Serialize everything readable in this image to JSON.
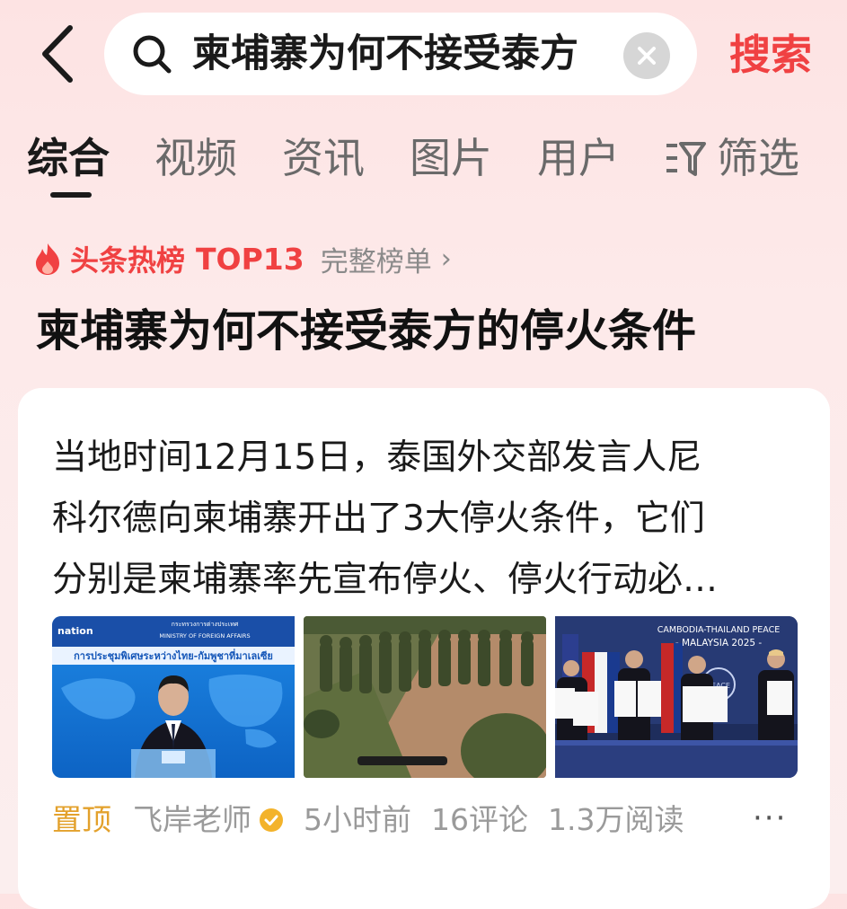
{
  "search": {
    "query": "柬埔寨为何不接受泰方",
    "submit_label": "搜索"
  },
  "tabs": [
    {
      "label": "综合",
      "active": true
    },
    {
      "label": "视频"
    },
    {
      "label": "资讯"
    },
    {
      "label": "图片"
    },
    {
      "label": "用户"
    },
    {
      "label": "筛选"
    }
  ],
  "hot": {
    "badge": "头条热榜",
    "rank": "TOP13",
    "full_list": "完整榜单",
    "title": "柬埔寨为何不接受泰方的停火条件"
  },
  "article": {
    "summary_lines": [
      "当地时间12月15日，泰国外交部发言人尼",
      "科尔德向柬埔寨开出了3大停火条件，它们",
      "分别是柬埔寨率先宣布停火、停火行动必…"
    ],
    "images": [
      {
        "logo": "nation",
        "ministry_thai": "กระทรวงการต่างประเทศ",
        "ministry_en": "MINISTRY OF FOREIGN AFFAIRS",
        "banner": "การประชุมพิเศษระหว่างไทย-กัมพูชาที่มาเลเซีย"
      },
      {},
      {
        "banner_line1": "CAMBODIA-THAILAND PEACE",
        "banner_line2": "- MALAYSIA 2025 -",
        "seal": "PEACE"
      }
    ],
    "pinned_label": "置顶",
    "author": "飞岸老师",
    "time": "5小时前",
    "comments": "16评论",
    "reads": "1.3万阅读",
    "more": "···"
  },
  "colors": {
    "accent_red": "#f04142",
    "pinned_orange": "#e3a12c",
    "verified_yellow": "#f3b32b"
  }
}
